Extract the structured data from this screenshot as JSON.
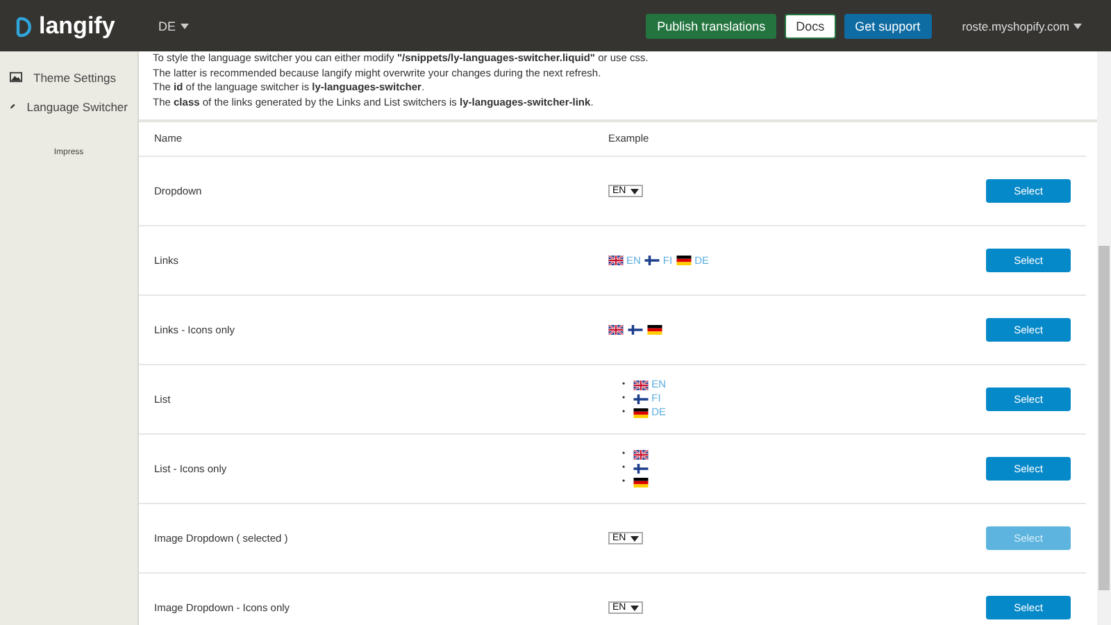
{
  "header": {
    "logo": "langify",
    "language": "DE",
    "buttons": [
      {
        "label": "Publish translations",
        "kind": "green"
      },
      {
        "label": "Docs",
        "kind": "white"
      },
      {
        "label": "Get support",
        "kind": "blue"
      }
    ],
    "account": "roste.myshopify.com"
  },
  "sidebar": {
    "items": [
      {
        "label": "Theme Settings",
        "kind": "image"
      },
      {
        "label": "Language Switcher",
        "kind": "pen"
      }
    ],
    "footer": "Impress"
  },
  "intro": [
    "To style the language switcher you can either modify **\"/snippets/ly-languages-switcher.liquid\"** or use css.",
    "The latter is recommended because langify might overwrite your changes during the next refresh.",
    "The **id** of the language switcher is **ly-languages-switcher**.",
    "The **class** of the links generated by the Links and List switchers is **ly-languages-switcher-link**."
  ],
  "table": {
    "columns": [
      "Name",
      "Example"
    ],
    "rows": [
      {
        "name": "Dropdown",
        "kind": "dropdown",
        "value": "EN",
        "button": "Select",
        "selected": false
      },
      {
        "name": "Links",
        "kind": "links",
        "flags": [
          {
            "kind": "gb",
            "label": "EN"
          },
          {
            "kind": "fi",
            "label": "FI"
          },
          {
            "kind": "de",
            "label": "DE"
          }
        ],
        "button": "Select",
        "selected": false
      },
      {
        "name": "Links - Icons only",
        "kind": "links",
        "flags": [
          {
            "kind": "gb"
          },
          {
            "kind": "fi"
          },
          {
            "kind": "de"
          }
        ],
        "button": "Select",
        "selected": false
      },
      {
        "name": "List",
        "kind": "list",
        "marker": "•",
        "flags": [
          {
            "kind": "gb",
            "label": "EN"
          },
          {
            "kind": "fi",
            "label": "FI"
          },
          {
            "kind": "de",
            "label": "DE"
          }
        ],
        "button": "Select",
        "selected": false
      },
      {
        "name": "List - Icons only",
        "kind": "list",
        "marker": "•",
        "flags": [
          {
            "kind": "gb"
          },
          {
            "kind": "fi"
          },
          {
            "kind": "de"
          }
        ],
        "button": "Select",
        "selected": false
      },
      {
        "name": "Image Dropdown ( selected )",
        "kind": "dropdown",
        "value": "EN",
        "button": "Select",
        "selected": true
      },
      {
        "name": "Image Dropdown - Icons only",
        "kind": "dropdown",
        "value": "EN",
        "button": "Select",
        "selected": false
      }
    ]
  }
}
